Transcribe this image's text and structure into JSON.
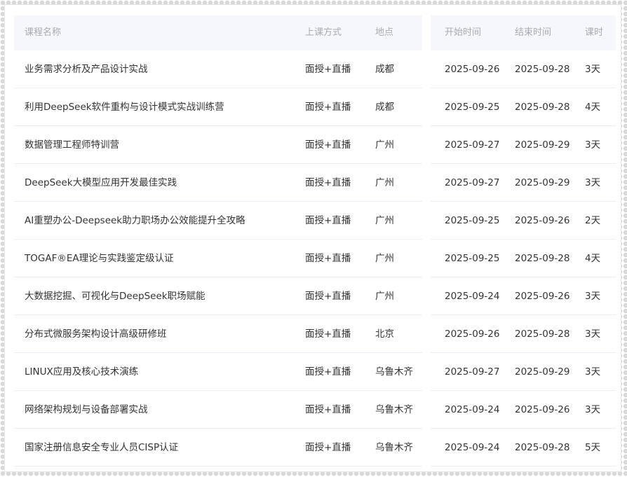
{
  "table": {
    "headers": {
      "name": "课程名称",
      "mode": "上课方式",
      "location": "地点",
      "start": "开始时间",
      "end": "结束时间",
      "duration": "课时"
    },
    "rows": [
      {
        "name": "业务需求分析及产品设计实战",
        "mode": "面授+直播",
        "location": "成都",
        "start": "2025-09-26",
        "end": "2025-09-28",
        "duration": "3天"
      },
      {
        "name": "利用DeepSeek软件重构与设计模式实战训练营",
        "mode": "面授+直播",
        "location": "成都",
        "start": "2025-09-25",
        "end": "2025-09-28",
        "duration": "4天"
      },
      {
        "name": "数据管理工程师特训营",
        "mode": "面授+直播",
        "location": "广州",
        "start": "2025-09-27",
        "end": "2025-09-29",
        "duration": "3天"
      },
      {
        "name": "DeepSeek大模型应用开发最佳实践",
        "mode": "面授+直播",
        "location": "广州",
        "start": "2025-09-27",
        "end": "2025-09-29",
        "duration": "3天"
      },
      {
        "name": "AI重塑办公-Deepseek助力职场办公效能提升全攻略",
        "mode": "面授+直播",
        "location": "广州",
        "start": "2025-09-25",
        "end": "2025-09-26",
        "duration": "2天"
      },
      {
        "name": "TOGAF®EA理论与实践鉴定级认证",
        "mode": "面授+直播",
        "location": "广州",
        "start": "2025-09-25",
        "end": "2025-09-28",
        "duration": "4天"
      },
      {
        "name": "大数据挖掘、可视化与DeepSeek职场赋能",
        "mode": "面授+直播",
        "location": "广州",
        "start": "2025-09-24",
        "end": "2025-09-26",
        "duration": "3天"
      },
      {
        "name": "分布式微服务架构设计高级研修班",
        "mode": "面授+直播",
        "location": "北京",
        "start": "2025-09-26",
        "end": "2025-09-28",
        "duration": "3天"
      },
      {
        "name": "LINUX应用及核心技术演练",
        "mode": "面授+直播",
        "location": "乌鲁木齐",
        "start": "2025-09-27",
        "end": "2025-09-29",
        "duration": "3天"
      },
      {
        "name": "网络架构规划与设备部署实战",
        "mode": "面授+直播",
        "location": "乌鲁木齐",
        "start": "2025-09-24",
        "end": "2025-09-26",
        "duration": "3天"
      },
      {
        "name": "国家注册信息安全专业人员CISP认证",
        "mode": "面授+直播",
        "location": "乌鲁木齐",
        "start": "2025-09-24",
        "end": "2025-09-28",
        "duration": "5天"
      }
    ]
  }
}
